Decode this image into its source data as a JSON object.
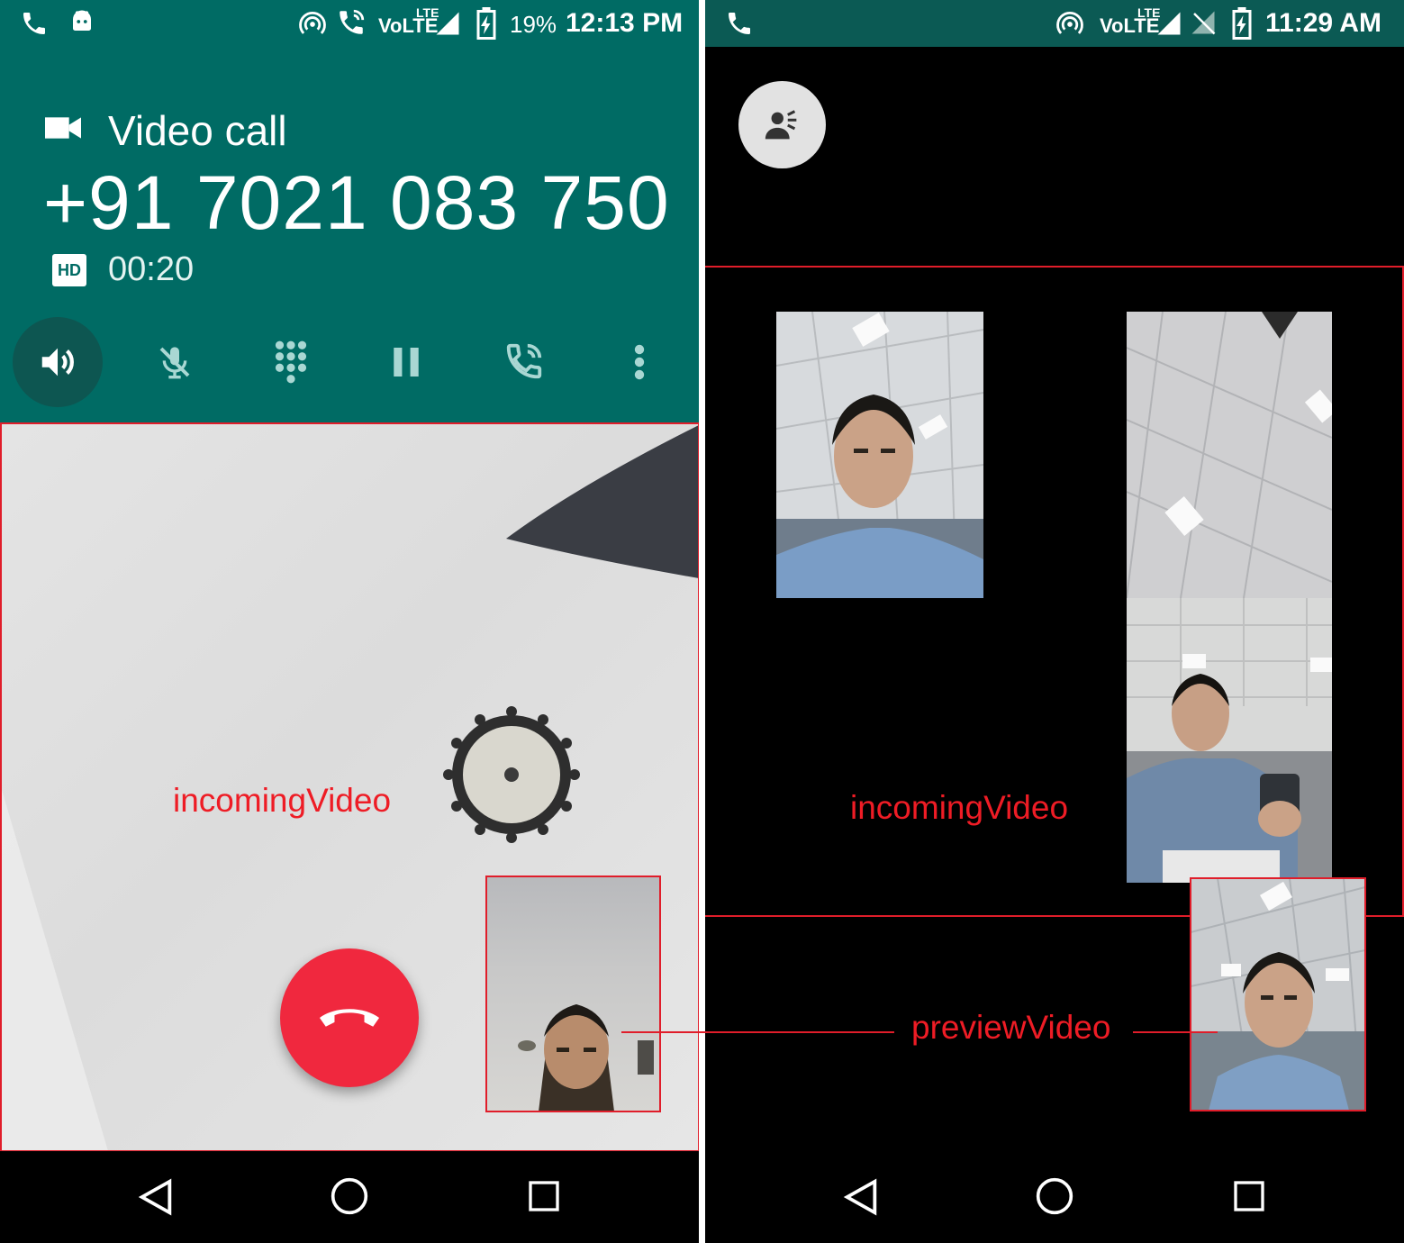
{
  "left_screen": {
    "status_bar": {
      "network_label": "VoLTE",
      "lte_label": "LTE",
      "battery_percent": "19%",
      "time": "12:13 PM"
    },
    "call": {
      "call_type": "Video call",
      "phone_number": "+91 7021 083 750",
      "hd_label": "HD",
      "duration": "00:20"
    },
    "controls": [
      "speaker-icon",
      "mute-icon",
      "dialpad-icon",
      "hold-icon",
      "add-call-icon",
      "more-options-icon"
    ],
    "incoming_video_label": "incomingVideo"
  },
  "right_screen": {
    "status_bar": {
      "network_label": "VoLTE",
      "lte_label": "LTE",
      "time": "11:29 AM"
    },
    "incoming_video_label": "incomingVideo",
    "preview_video_label": "previewVideo"
  },
  "colors": {
    "header_teal": "#006b64",
    "end_call_red": "#f0283e",
    "annotation_red": "#ee1c25"
  }
}
